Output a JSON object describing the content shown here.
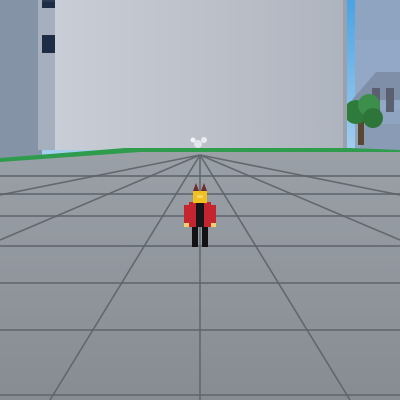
{
  "scene": {
    "title": "",
    "elements": [
      "player-avatar",
      "tiled-plaza-floor",
      "tall-building",
      "left-building",
      "right-building",
      "tree",
      "grass-strip",
      "sky"
    ]
  },
  "colors": {
    "sky": "#4aa3e3",
    "building_main": "#b7bcc6",
    "building_left": "#8f9aa8",
    "floor": "#8d9299",
    "floor_grid": "#5f646b",
    "grass": "#2f9b4d",
    "avatar_body": "#c5252f",
    "avatar_head": "#f0c020"
  },
  "icons": {
    "player": "player-avatar-icon",
    "tree": "tree-icon",
    "sparkle": "sparkle-icon"
  }
}
